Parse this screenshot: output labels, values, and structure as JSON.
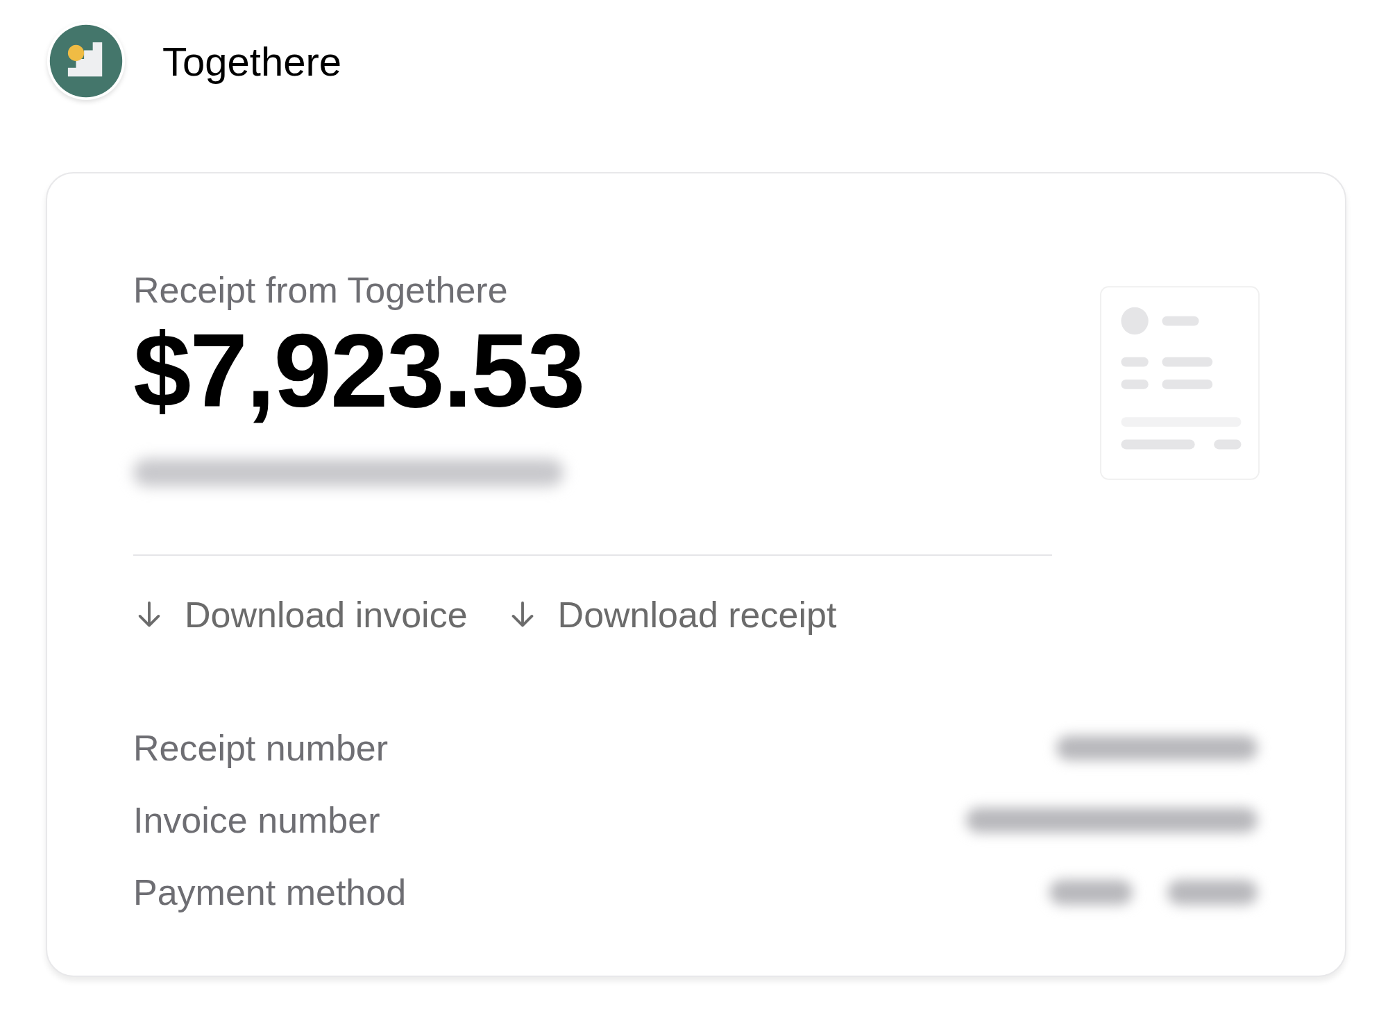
{
  "brand": {
    "name": "Togethere"
  },
  "receipt": {
    "title": "Receipt from Togethere",
    "amount": "$7,923.53"
  },
  "actions": [
    {
      "label": "Download invoice"
    },
    {
      "label": "Download receipt"
    }
  ],
  "details": [
    {
      "label": "Receipt number"
    },
    {
      "label": "Invoice number"
    },
    {
      "label": "Payment method"
    }
  ]
}
